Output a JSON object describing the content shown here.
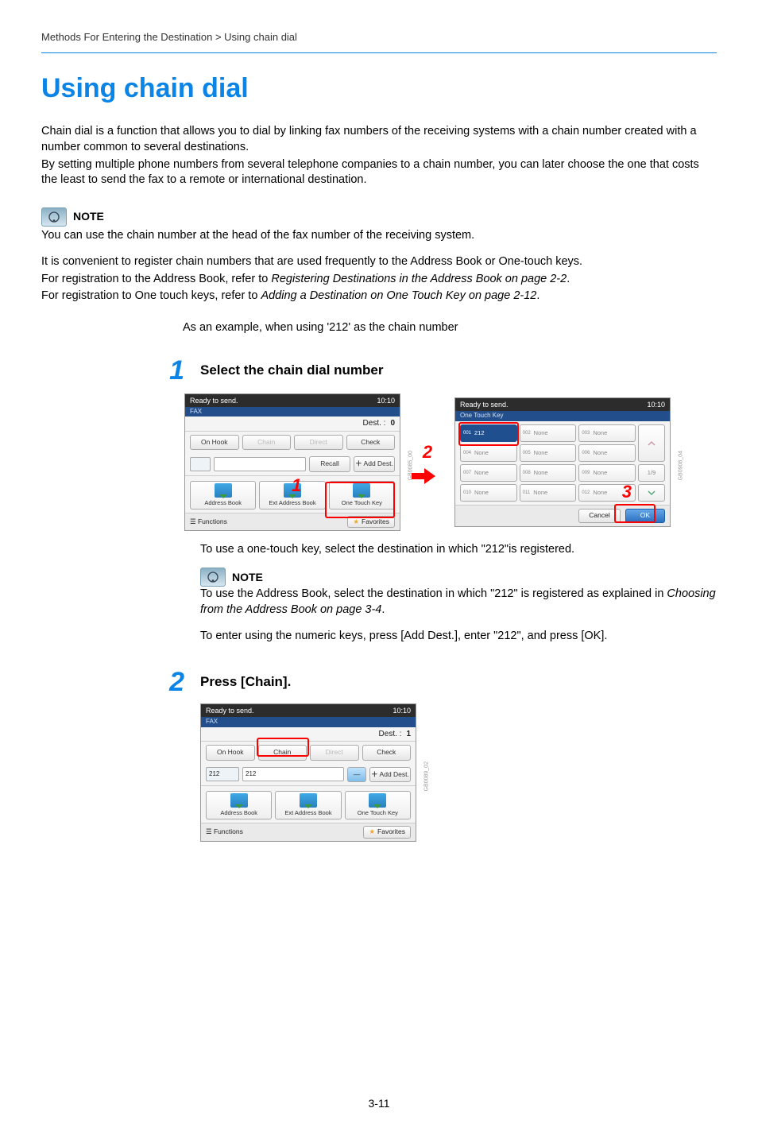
{
  "breadcrumb": "Methods For Entering the Destination > Using chain dial",
  "title": "Using chain dial",
  "intro1": "Chain dial is a function that allows you to dial by linking fax numbers of the receiving systems with a chain number created with a number common to several destinations.",
  "intro2": "By setting multiple phone numbers from several telephone companies to a chain number, you can later choose the one that costs the least to send the fax to a remote or international destination.",
  "noteLabel": "NOTE",
  "note1a": "You can use the chain number at the head of the fax number of the receiving system.",
  "note1b": "It is convenient to register chain numbers that are used frequently to the Address Book or One-touch keys.",
  "note1c_pre": "For registration to the Address Book, refer to ",
  "note1c_link": "Registering Destinations in the Address Book on page 2-2",
  "note1d_pre": "For registration to One touch keys, refer to ",
  "note1d_link": "Adding a Destination on One Touch Key on page 2-12",
  "example": "As an example, when using '212' as the chain number",
  "step1_num": "1",
  "step1_title": "Select the chain dial number",
  "step1_after": "To use a one-touch key, select the destination in which \"212\"is registered.",
  "step1_note1_pre": "To use the Address Book, select the destination in which \"212\" is registered as explained in ",
  "step1_note1_link": "Choosing from the Address Book on page 3-4",
  "step1_note2": "To enter using the numeric keys, press [Add Dest.], enter \"212\", and press [OK].",
  "step2_num": "2",
  "step2_title": "Press [Chain].",
  "pageNumber": "3-11",
  "panel": {
    "ready": "Ready to send.",
    "time": "10:10",
    "faxLabel": "FAX",
    "otkLabel": "One Touch Key",
    "destLabel": "Dest. :",
    "destCount0": "0",
    "destCount1": "1",
    "onHook": "On Hook",
    "chain": "Chain",
    "direct": "Direct",
    "check": "Check",
    "recall": "Recall",
    "addDest": "Add Dest.",
    "addressBook": "Address Book",
    "extAddressBook": "Ext Address Book",
    "oneTouchKey": "One Touch Key",
    "functions": "Functions",
    "favorites": "Favorites",
    "cancel": "Cancel",
    "ok": "OK",
    "pager": "1/9",
    "val212": "212",
    "otk": {
      "c001": "001",
      "c002": "002",
      "c003": "003",
      "c004": "004",
      "c005": "005",
      "c006": "006",
      "c007": "007",
      "c008": "008",
      "c009": "009",
      "c010": "010",
      "c011": "011",
      "c012": "012",
      "v001": "212",
      "none": "None"
    },
    "code00": "GB0085_00",
    "code02": "GB0089_02",
    "code04": "GB0908_04"
  },
  "callouts": {
    "n1": "1",
    "n2": "2",
    "n3": "3"
  }
}
